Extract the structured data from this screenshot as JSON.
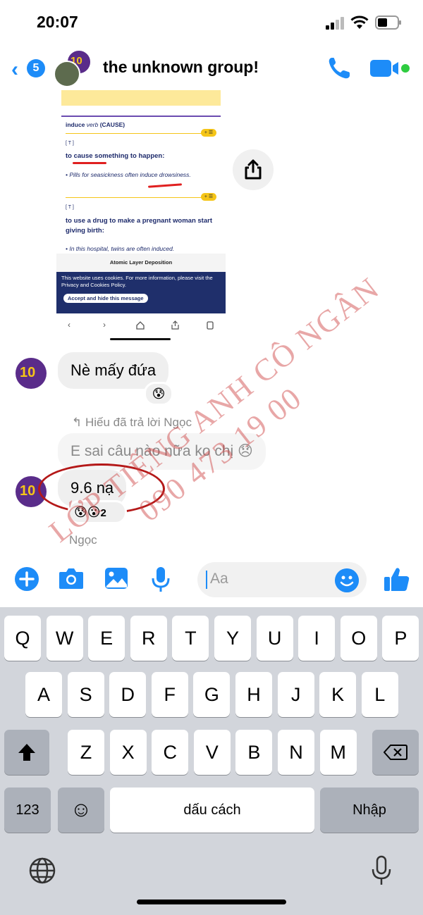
{
  "status_bar": {
    "time": "20:07"
  },
  "header": {
    "back_count": "5",
    "title": "the unknown group!",
    "avatar_badge": "10"
  },
  "shared_image": {
    "entry_word": "induce",
    "entry_pos": "verb",
    "entry_label": "(CAUSE)",
    "grammar_1": "[ T ]",
    "def_1": "to cause something to happen:",
    "example_1": "• Pills for seasickness often induce drowsiness.",
    "grammar_2": "[ T ]",
    "def_2": "to use a drug to make a pregnant woman start giving birth:",
    "example_2": "• In this hospital, twins are often induced.",
    "pill_label": "+ ☰",
    "ad_title": "Atomic Layer Deposition",
    "cookie_text": "This website uses cookies. For more information, please visit the Privacy and Cookies Policy.",
    "cookie_button": "Accept and hide this message",
    "nav_back": "‹",
    "nav_forward": "›"
  },
  "messages": {
    "msg1": "Nè mấy đứa",
    "msg1_reaction": "😰",
    "reply_note": "Hiếu đã trả lời Ngọc",
    "reply_quote": "E sai câu nào nữa ko chị 😞",
    "msg2": "9.6 nạ",
    "msg2_reactions": "😰😮",
    "msg2_reaction_count": "2",
    "sender_name": "Ngọc",
    "avatar_badge": "10"
  },
  "composer": {
    "placeholder": "Aa"
  },
  "keyboard": {
    "row1": [
      "Q",
      "W",
      "E",
      "R",
      "T",
      "Y",
      "U",
      "I",
      "O",
      "P"
    ],
    "row2": [
      "A",
      "S",
      "D",
      "F",
      "G",
      "H",
      "J",
      "K",
      "L"
    ],
    "row3": [
      "Z",
      "X",
      "C",
      "V",
      "B",
      "N",
      "M"
    ],
    "numbers_key": "123",
    "emoji_key": "☺",
    "space_key": "dấu cách",
    "return_key": "Nhập"
  },
  "watermark": {
    "line1": "LỚP TIẾNG ANH CÔ NGÂN",
    "line2": "090 473 19 00"
  },
  "colors": {
    "accent": "#1d8cf8",
    "bubble": "#efefef",
    "keyboard_bg": "#d2d5db",
    "watermark": "#cd3c3c",
    "annotation": "#b41818"
  }
}
